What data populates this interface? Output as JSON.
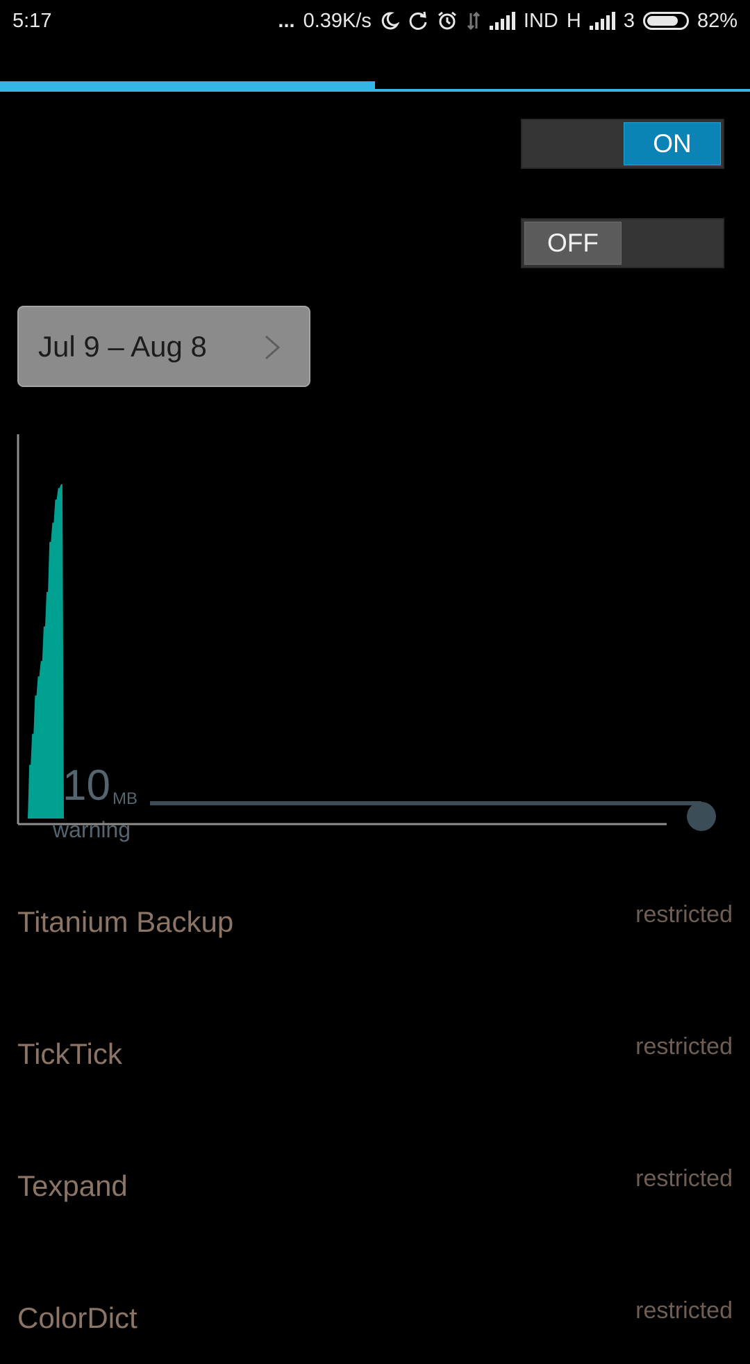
{
  "status_bar": {
    "time": "5:17",
    "dots": "...",
    "speed": "0.39K/s",
    "carrier": "IND",
    "network_type": "H",
    "sim2_label": "3",
    "battery": "82%",
    "battery_level": 82,
    "icons": [
      "moon-icon",
      "sync-icon",
      "alarm-icon",
      "data-arrows-icon",
      "signal-icon",
      "signal-icon"
    ]
  },
  "tabs": {
    "accent_color": "#33b5e5"
  },
  "toggles": {
    "first": {
      "state": "ON",
      "color": "#0b83b4"
    },
    "second": {
      "state": "OFF",
      "color": "#5b5b5b"
    }
  },
  "date_range": {
    "label": "Jul 9 – Aug 8",
    "icon": "chevron-right-icon"
  },
  "chart_data": {
    "type": "area",
    "series_color": "#00a191",
    "warning": {
      "value": "10",
      "unit": "MB",
      "label": "warning"
    },
    "usage_profile": [
      0.0,
      0.14,
      0.14,
      0.22,
      0.22,
      0.32,
      0.32,
      0.37,
      0.37,
      0.41,
      0.41,
      0.5,
      0.5,
      0.59,
      0.59,
      0.72,
      0.72,
      0.77,
      0.77,
      0.83,
      0.83,
      0.86,
      0.86,
      0.87,
      0.87,
      0.0
    ]
  },
  "apps": [
    {
      "name": "Titanium Backup",
      "status": "restricted"
    },
    {
      "name": "TickTick",
      "status": "restricted"
    },
    {
      "name": "Texpand",
      "status": "restricted"
    },
    {
      "name": "ColorDict",
      "status": "restricted"
    }
  ]
}
